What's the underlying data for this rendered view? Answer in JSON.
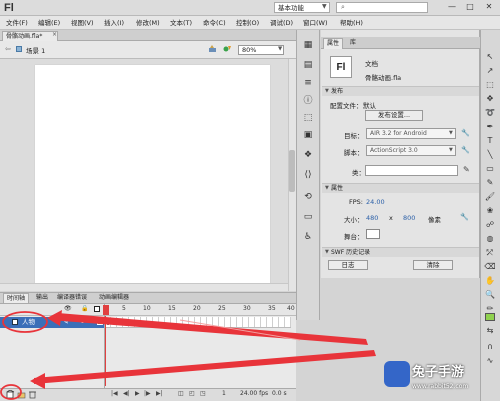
{
  "app": {
    "logo": "Fl",
    "workspace": "基本功能",
    "search_placeholder": ""
  },
  "window_controls": [
    "—",
    "□",
    "✕"
  ],
  "menu": [
    "文件(F)",
    "编辑(E)",
    "视图(V)",
    "插入(I)",
    "修改(M)",
    "文本(T)",
    "命令(C)",
    "控制(O)",
    "调试(D)",
    "窗口(W)",
    "帮助(H)"
  ],
  "document": {
    "tab": "骨骼动画.fla*",
    "scene": "场景 1",
    "zoom": "80%"
  },
  "timeline": {
    "tabs": [
      "时间轴",
      "输出",
      "编译器错误",
      "动画编辑器"
    ],
    "layer_name": "人物",
    "frame_numbers": [
      "5",
      "10",
      "15",
      "20",
      "25",
      "30",
      "35",
      "40"
    ],
    "footer": {
      "current_frame": "1",
      "fps": "24.00 fps",
      "time": "0.0 s"
    }
  },
  "properties": {
    "tabs": [
      "属性",
      "库"
    ],
    "doc_badge": "Fl",
    "doc_type": "文档",
    "doc_name": "骨骼动画.fla",
    "publish_section": "发布",
    "profile_label": "配置文件：",
    "profile_value": "默认",
    "publish_settings_button": "发布设置...",
    "target_label": "目标：",
    "target_value": "AIR 3.2 for Android",
    "script_label": "脚本：",
    "script_value": "ActionScript 3.0",
    "class_label": "类：",
    "class_value": "",
    "props_section": "属性",
    "fps_label": "FPS:",
    "fps_value": "24.00",
    "size_label": "大小：",
    "width": "480",
    "x": "x",
    "height": "800",
    "units": "像素",
    "stage_label": "舞台：",
    "stage_color": "#ffffff",
    "swf_section": "SWF 历史记录",
    "log_button": "日志",
    "clear_button": "清除"
  },
  "watermark": {
    "title": "兔子手游",
    "url": "www.rabbit52.com"
  },
  "colors": {
    "annotation": "#e8343a",
    "layer_selected": "#3b6fb8",
    "link": "#2a5fa8"
  }
}
